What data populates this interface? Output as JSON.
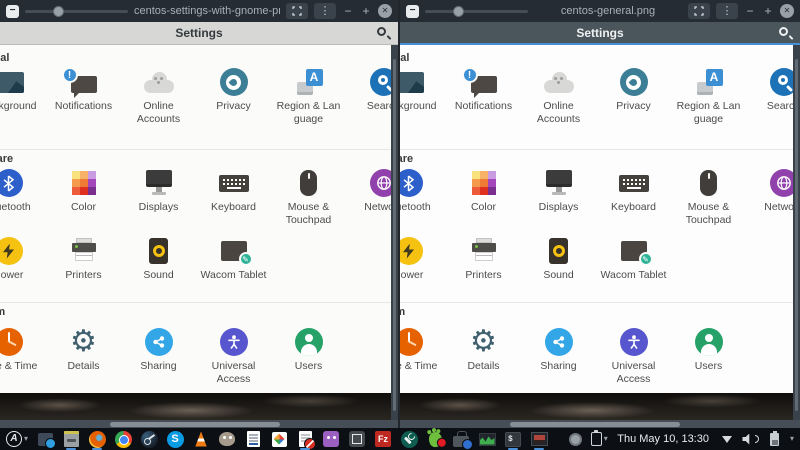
{
  "glyphs": {
    "minus": "−",
    "plus": "+",
    "close": "✕",
    "kebab": "⋮",
    "caret_down": "▾",
    "exclamation": "!",
    "region_letter": "A",
    "gear": "⚙",
    "pencil": "✎"
  },
  "windows": [
    {
      "title": "centos-settings-with-gnome-pro.png",
      "header_style": "light"
    },
    {
      "title": "centos-general.png",
      "header_style": "dark"
    }
  ],
  "settings_app": {
    "header_title": "Settings",
    "sections": [
      {
        "name": "personal",
        "label": "Personal",
        "rows": [
          [
            {
              "name": "background",
              "label": "Background",
              "icon": "background-photo-icon",
              "lines": [
                "Background"
              ]
            },
            {
              "name": "notifications",
              "label": "Notifications",
              "icon": "notifications-icon",
              "lines": [
                "Notifications"
              ]
            },
            {
              "name": "online-accounts",
              "label": "Online Accounts",
              "icon": "online-accounts-cloud-icon",
              "lines": [
                "Online",
                "Accounts"
              ]
            },
            {
              "name": "privacy",
              "label": "Privacy",
              "icon": "privacy-icon",
              "lines": [
                "Privacy"
              ]
            },
            {
              "name": "region-language",
              "label": "Region & Language",
              "icon": "region-language-icon",
              "lines": [
                "Region & Lan",
                "guage"
              ]
            },
            {
              "name": "search",
              "label": "Search",
              "icon": "search-tile-icon",
              "lines": [
                "Search"
              ]
            }
          ]
        ]
      },
      {
        "name": "hardware",
        "label": "Hardware",
        "rows": [
          [
            {
              "name": "bluetooth",
              "label": "Bluetooth",
              "icon": "bluetooth-icon",
              "lines": [
                "Bluetooth"
              ]
            },
            {
              "name": "color",
              "label": "Color",
              "icon": "color-palette-icon",
              "lines": [
                "Color"
              ]
            },
            {
              "name": "displays",
              "label": "Displays",
              "icon": "displays-icon",
              "lines": [
                "Displays"
              ]
            },
            {
              "name": "keyboard",
              "label": "Keyboard",
              "icon": "keyboard-icon",
              "lines": [
                "Keyboard"
              ]
            },
            {
              "name": "mouse-touchpad",
              "label": "Mouse & Touchpad",
              "icon": "mouse-icon",
              "lines": [
                "Mouse &",
                "Touchpad"
              ]
            },
            {
              "name": "network",
              "label": "Network",
              "icon": "network-globe-icon",
              "lines": [
                "Network"
              ]
            }
          ],
          [
            {
              "name": "power",
              "label": "Power",
              "icon": "power-bolt-icon",
              "lines": [
                "Power"
              ]
            },
            {
              "name": "printers",
              "label": "Printers",
              "icon": "printers-icon",
              "lines": [
                "Printers"
              ]
            },
            {
              "name": "sound",
              "label": "Sound",
              "icon": "sound-speaker-icon",
              "lines": [
                "Sound"
              ]
            },
            {
              "name": "wacom-tablet",
              "label": "Wacom Tablet",
              "icon": "wacom-tablet-icon",
              "lines": [
                "Wacom Tablet"
              ]
            }
          ]
        ]
      },
      {
        "name": "system",
        "label": "System",
        "rows": [
          [
            {
              "name": "date-time",
              "label": "Date & Time",
              "icon": "clock-icon",
              "lines": [
                "Date & Time"
              ]
            },
            {
              "name": "details",
              "label": "Details",
              "icon": "gear-icon",
              "lines": [
                "Details"
              ]
            },
            {
              "name": "sharing",
              "label": "Sharing",
              "icon": "sharing-nodes-icon",
              "lines": [
                "Sharing"
              ]
            },
            {
              "name": "universal-access",
              "label": "Universal Access",
              "icon": "universal-access-icon",
              "lines": [
                "Universal",
                "Access"
              ]
            },
            {
              "name": "users",
              "label": "Users",
              "icon": "users-icon",
              "lines": [
                "Users"
              ]
            }
          ]
        ]
      }
    ]
  },
  "taskbar": {
    "applications_menu": {
      "label": "A"
    },
    "apps": [
      {
        "name": "screenshot-tool",
        "icon": "screenshot-icon"
      },
      {
        "name": "file-manager",
        "icon": "file-cabinet-icon",
        "running": true
      },
      {
        "name": "firefox",
        "icon": "firefox-icon",
        "running": true
      },
      {
        "name": "chrome",
        "icon": "chrome-icon"
      },
      {
        "name": "steam",
        "icon": "steam-icon"
      },
      {
        "name": "skype",
        "icon": "skype-icon",
        "label": "S"
      },
      {
        "name": "vlc",
        "icon": "vlc-cone-icon"
      },
      {
        "name": "gimp",
        "icon": "gimp-icon"
      },
      {
        "name": "writer",
        "icon": "writer-document-icon"
      },
      {
        "name": "wps-office",
        "icon": "wps-office-icon"
      },
      {
        "name": "document-editor",
        "icon": "document-editor-icon",
        "running": true
      },
      {
        "name": "purple-app",
        "icon": "purple-mascot-icon"
      },
      {
        "name": "boxes",
        "icon": "boxes-icon"
      },
      {
        "name": "filezilla",
        "icon": "filezilla-icon",
        "label": "Fz"
      },
      {
        "name": "maintenance-tool",
        "icon": "wrench-gear-icon"
      },
      {
        "name": "software-updates",
        "icon": "gnome-foot-icon"
      },
      {
        "name": "toolbox",
        "icon": "toolbox-icon"
      },
      {
        "name": "system-monitor",
        "icon": "system-monitor-icon"
      },
      {
        "name": "terminal",
        "icon": "terminal-icon",
        "label": "$",
        "running": true
      },
      {
        "name": "image-viewer",
        "icon": "image-viewer-icon",
        "running": true
      }
    ],
    "clock": "Thu May 10, 13:30"
  }
}
